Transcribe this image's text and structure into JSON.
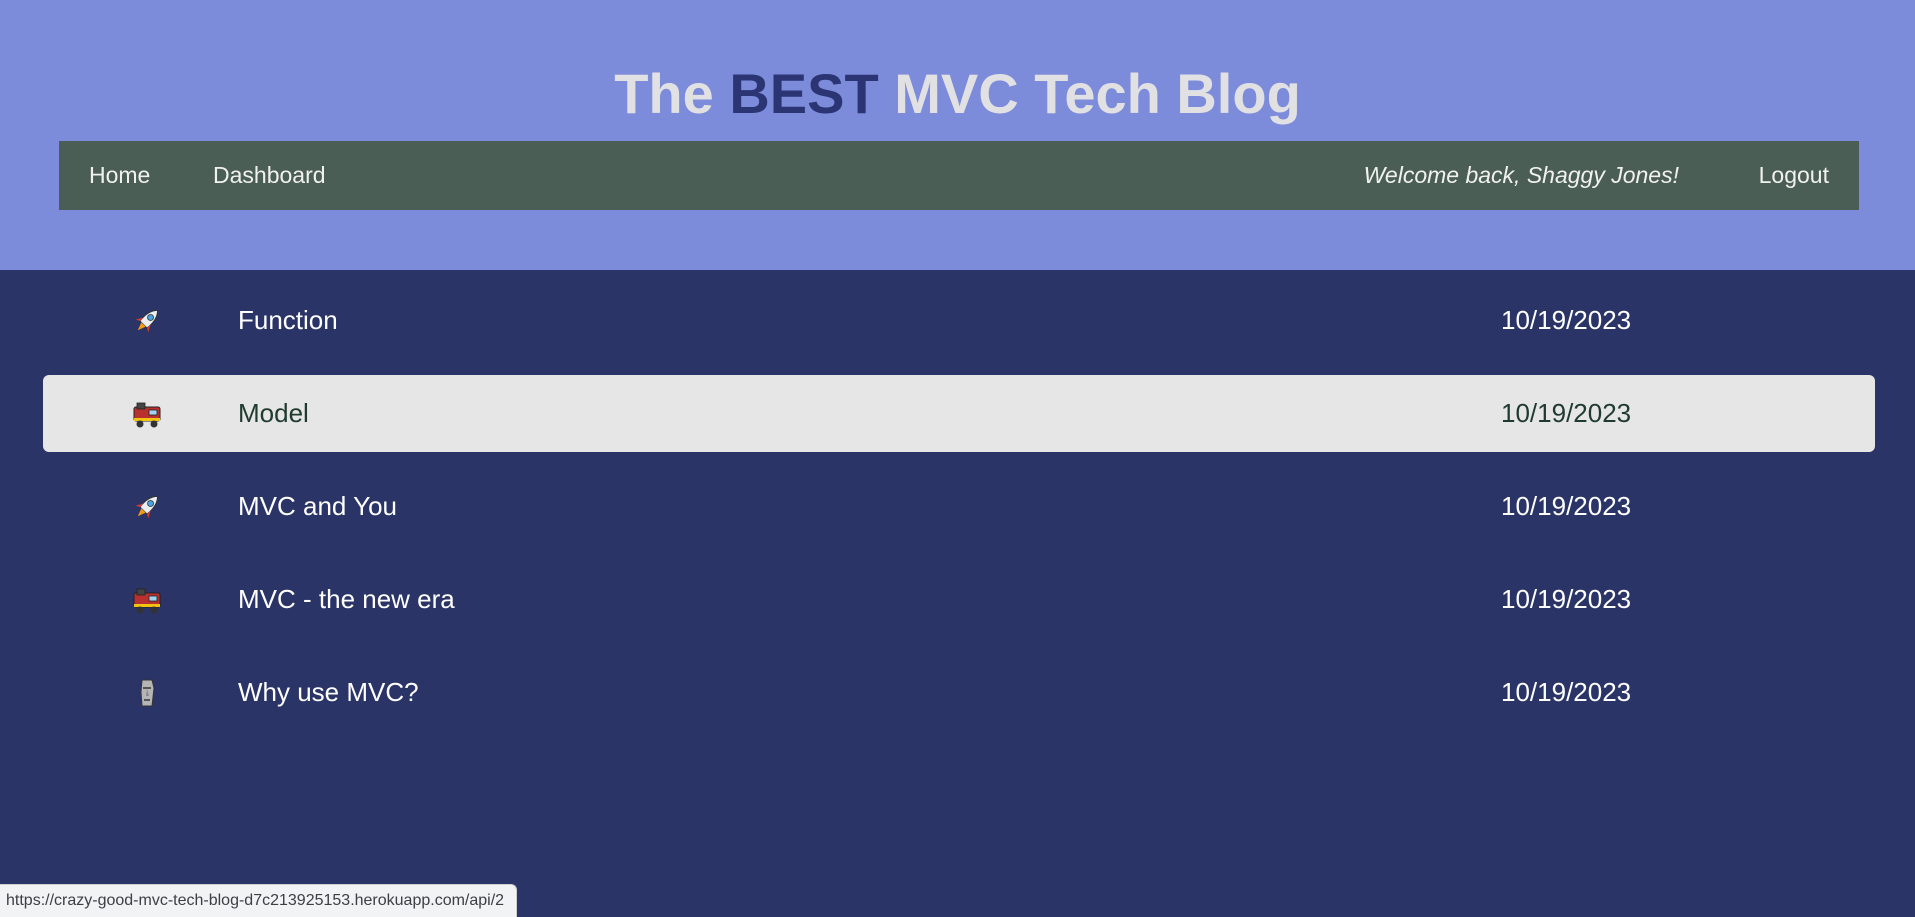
{
  "header": {
    "title_before": "The ",
    "title_accent": "BEST",
    "title_after": " MVC Tech Blog"
  },
  "nav": {
    "home_label": "Home",
    "dashboard_label": "Dashboard",
    "welcome_text": "Welcome back, Shaggy Jones!",
    "logout_label": "Logout"
  },
  "posts": [
    {
      "icon": "rocket-icon",
      "title": "Function",
      "date": "10/19/2023"
    },
    {
      "icon": "locomotive-icon",
      "title": "Model",
      "date": "10/19/2023"
    },
    {
      "icon": "rocket-icon",
      "title": "MVC and You",
      "date": "10/19/2023"
    },
    {
      "icon": "locomotive-icon",
      "title": "MVC - the new era",
      "date": "10/19/2023"
    },
    {
      "icon": "moai-icon",
      "title": "Why use MVC?",
      "date": "10/19/2023"
    }
  ],
  "status_bar": {
    "url": "https://crazy-good-mvc-tech-blog-d7c213925153.herokuapp.com/api/2"
  },
  "colors": {
    "header_bg": "#7d8bdb",
    "nav_bg": "#4b5e55",
    "page_bg": "#2b3467",
    "title_accent": "#2b3573",
    "highlight_row": "#e6e6e6"
  }
}
